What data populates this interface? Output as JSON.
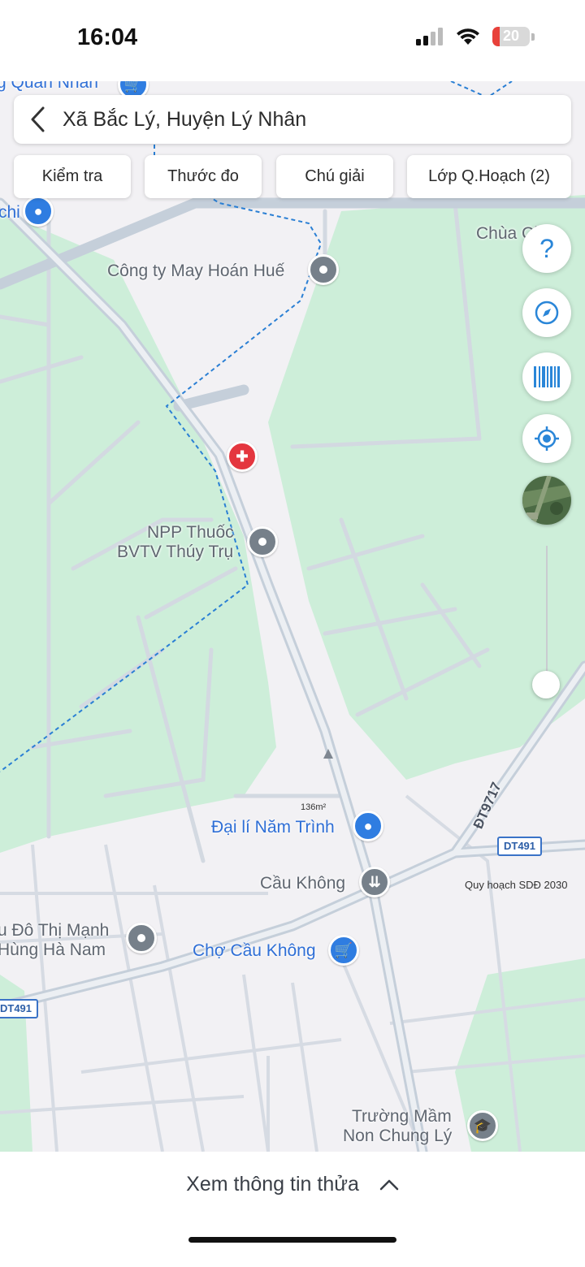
{
  "status_bar": {
    "time": "16:04",
    "battery_level": "20"
  },
  "search": {
    "title": "Xã Bắc Lý, Huyện Lý Nhân"
  },
  "toolbar": {
    "buttons": [
      "Kiểm tra",
      "Thước đo",
      "Chú giải",
      "Lớp Q.Hoạch (2)"
    ]
  },
  "map": {
    "labels": {
      "chua": "Chùa Ch",
      "quan_nhan": "g Quan Nhân",
      "chi": "chi",
      "cong_ty": "Công ty May Hoán Huế",
      "npp_line1": "NPP Thuốc",
      "npp_line2": "BVTV Thúy Trụ",
      "dai_li": "Đại lí Năm Trình",
      "cau_khong": "Cầu Không",
      "do_thi_line1": "u Đô Thị Mạnh",
      "do_thi_line2": "Hùng Hà Nam",
      "cho": "Chợ Cầu Không",
      "truong_line1": "Trường Mầm",
      "truong_line2": "Non Chung Lý"
    },
    "area": "136m²",
    "roads": {
      "dt9717": "ĐT9717",
      "dt491_right": "DT491",
      "dt491_left": "DT491"
    },
    "overlay_caption": "Quy hoạch SDĐ 2030"
  },
  "controls": {
    "help_label": "?"
  },
  "bottom_sheet": {
    "label": "Xem thông tin thửa"
  },
  "colors": {
    "green_zone": "#cdeed9",
    "road": "#c9d3dd",
    "accent": "#2a86d8",
    "poi_red": "#e4363f",
    "poi_blue": "#2f7de1",
    "poi_gray": "#76808a"
  }
}
